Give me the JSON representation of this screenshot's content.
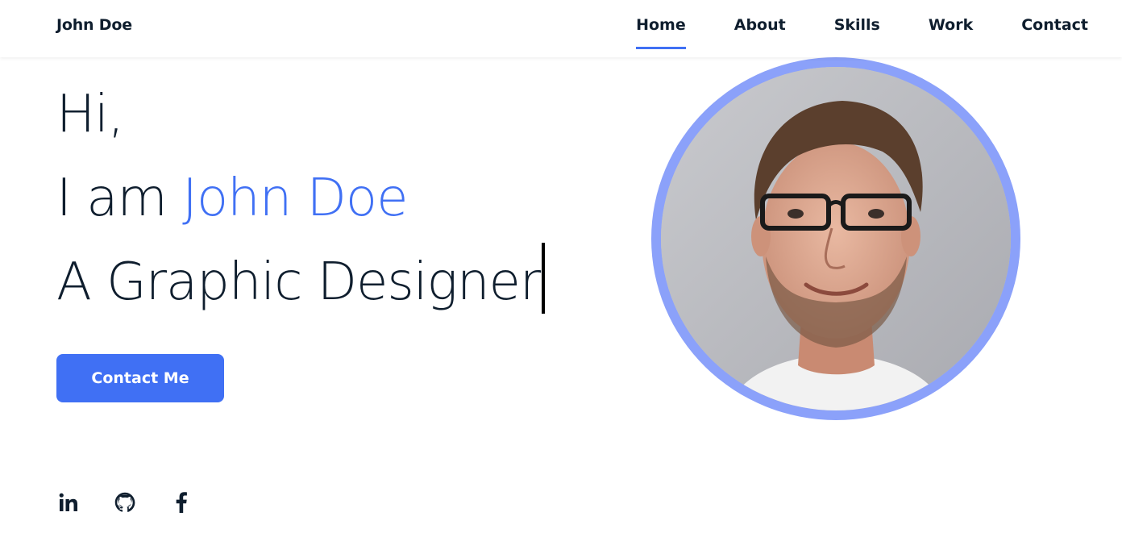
{
  "header": {
    "logo": "John Doe",
    "nav": [
      {
        "label": "Home",
        "active": true
      },
      {
        "label": "About",
        "active": false
      },
      {
        "label": "Skills",
        "active": false
      },
      {
        "label": "Work",
        "active": false
      },
      {
        "label": "Contact",
        "active": false
      }
    ]
  },
  "hero": {
    "greeting": "Hi,",
    "intro_prefix": "I am ",
    "name": "John Doe",
    "role": "A Graphic Designer",
    "cta_label": "Contact Me"
  },
  "social": [
    {
      "icon": "linkedin-icon"
    },
    {
      "icon": "github-icon"
    },
    {
      "icon": "facebook-icon"
    }
  ],
  "colors": {
    "accent": "#4070f4",
    "ring": "#8ba1fa",
    "text": "#0f1e2e"
  }
}
